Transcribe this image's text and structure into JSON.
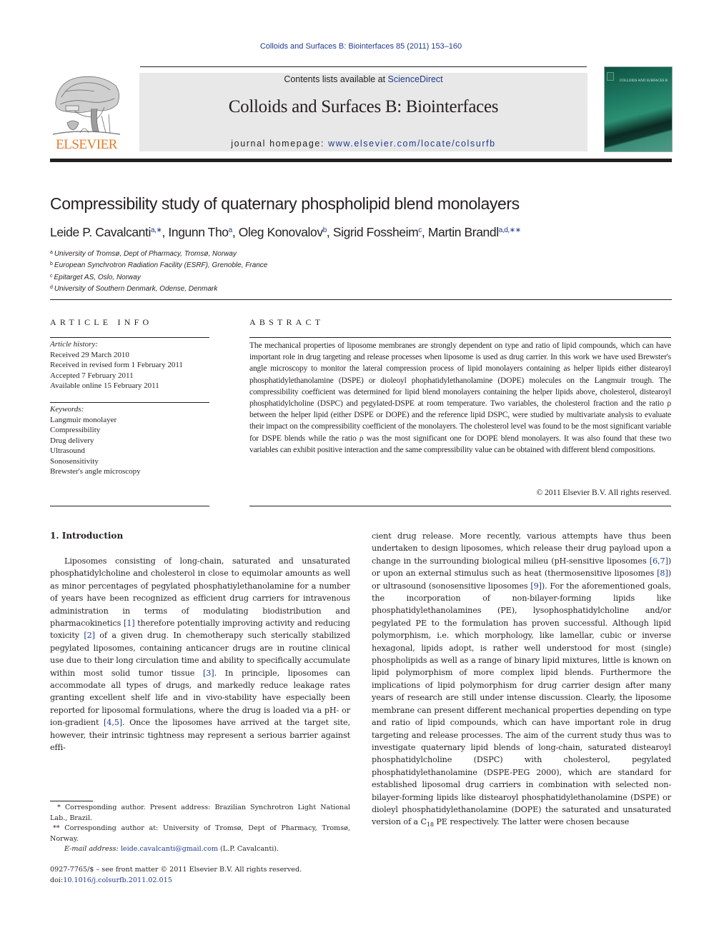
{
  "header": {
    "citation": "Colloids and Surfaces B: Biointerfaces 85 (2011) 153–160",
    "contents_prefix": "Contents lists available at ",
    "contents_link": "ScienceDirect",
    "journal_title": "Colloids and Surfaces B: Biointerfaces",
    "homepage_prefix": "journal homepage: ",
    "homepage_link": "www.elsevier.com/locate/colsurfb",
    "publisher_logo_text": "ELSEVIER",
    "cover_title": "COLLOIDS AND SURFACES B",
    "colors": {
      "link": "#1f3b8c",
      "publisher_orange": "#e8792a",
      "banner_bg": "#e8e8e8",
      "cover_green": "#1e7a62"
    }
  },
  "article": {
    "title": "Compressibility study of quaternary phospholipid blend monolayers",
    "authors": [
      {
        "name": "Leide P. Cavalcanti",
        "sup": "a,∗"
      },
      {
        "name": "Ingunn Tho",
        "sup": "a"
      },
      {
        "name": "Oleg Konovalov",
        "sup": "b"
      },
      {
        "name": "Sigrid Fossheim",
        "sup": "c"
      },
      {
        "name": "Martin Brandl",
        "sup": "a,d,∗∗"
      }
    ],
    "affiliations": [
      {
        "key": "a",
        "text": "University of Tromsø, Dept of Pharmacy, Tromsø, Norway"
      },
      {
        "key": "b",
        "text": "European Synchrotron Radiation Facility (ESRF), Grenoble, France"
      },
      {
        "key": "c",
        "text": "Epitarget AS, Oslo, Norway"
      },
      {
        "key": "d",
        "text": "University of Southern Denmark, Odense, Denmark"
      }
    ]
  },
  "article_info": {
    "heading": "ARTICLE INFO",
    "history_label": "Article history:",
    "history": [
      "Received 29 March 2010",
      "Received in revised form 1 February 2011",
      "Accepted 7 February 2011",
      "Available online 15 February 2011"
    ],
    "keywords_label": "Keywords:",
    "keywords": [
      "Langmuir monolayer",
      "Compressibility",
      "Drug delivery",
      "Ultrasound",
      "Sonosensitivity",
      "Brewster's angle microscopy"
    ]
  },
  "abstract": {
    "heading": "ABSTRACT",
    "text": "The mechanical properties of liposome membranes are strongly dependent on type and ratio of lipid compounds, which can have important role in drug targeting and release processes when liposome is used as drug carrier. In this work we have used Brewster's angle microscopy to monitor the lateral compression process of lipid monolayers containing as helper lipids either distearoyl phosphatidylethanolamine (DSPE) or dioleoyl phophatidylethanolamine (DOPE) molecules on the Langmuir trough. The compressibility coefficient was determined for lipid blend monolayers containing the helper lipids above, cholesterol, distearoyl phosphatidylcholine (DSPC) and pegylated-DSPE at room temperature. Two variables, the cholesterol fraction and the ratio ρ between the helper lipid (either DSPE or DOPE) and the reference lipid DSPC, were studied by multivariate analysis to evaluate their impact on the compressibility coefficient of the monolayers. The cholesterol level was found to be the most significant variable for DSPE blends while the ratio ρ was the most significant one for DOPE blend monolayers. It was also found that these two variables can exhibit positive interaction and the same compressibility value can be obtained with different blend compositions.",
    "copyright": "© 2011 Elsevier B.V. All rights reserved."
  },
  "introduction": {
    "heading": "1.  Introduction",
    "left_column": [
      {
        "t": "Liposomes consisting of long-chain, saturated and unsaturated phosphatidylcholine and cholesterol in close to equimolar amounts as well as minor percentages of pegylated phosphatiylethanolamine for a number of years have been recognized as efficient drug carriers for intravenous administration in terms of modulating biodistribution and pharmacokinetics "
      },
      {
        "ref": "[1]"
      },
      {
        "t": " therefore potentially improving activity and reducing toxicity "
      },
      {
        "ref": "[2]"
      },
      {
        "t": " of a given drug. In chemotherapy such sterically stabilized pegylated liposomes, containing anticancer drugs are in routine clinical use due to their long circulation time and ability to specifically accumulate within most solid tumor tissue "
      },
      {
        "ref": "[3]"
      },
      {
        "t": ". In principle, liposomes can accommodate all types of drugs, and markedly reduce leakage rates granting excellent shelf life and in vivo-stability have especially been reported for liposomal formulations, where the drug is loaded via a pH- or ion-gradient "
      },
      {
        "ref": "[4,5]"
      },
      {
        "t": ". Once the liposomes have arrived at the target site, however, their intrinsic tightness may represent a serious barrier against effi-"
      }
    ],
    "right_column": [
      {
        "t": "cient drug release. More recently, various attempts have thus been undertaken to design liposomes, which release their drug payload upon a change in the surrounding biological milieu (pH-sensitive liposomes "
      },
      {
        "ref": "[6,7]"
      },
      {
        "t": ") or upon an external stimulus such as heat (thermosensitive liposomes "
      },
      {
        "ref": "[8]"
      },
      {
        "t": ") or ultrasound (sonosensitive liposomes "
      },
      {
        "ref": "[9]"
      },
      {
        "t": "). For the aforementioned goals, the incorporation of non-bilayer-forming lipids like phosphatidylethanolamines (PE), lysophosphatidylcholine and/or pegylated PE to the formulation has proven successful. Although lipid polymorphism, i.e. which morphology, like lamellar, cubic or inverse hexagonal, lipids adopt, is rather well understood for most (single) phospholipids as well as a range of binary lipid mixtures, little is known on lipid polymorphism of more complex lipid blends. Furthermore the implications of lipid polymorphism for drug carrier design after many years of research are still under intense discussion. Clearly, the liposome membrane can present different mechanical properties depending on type and ratio of lipid compounds, which can have important role in drug targeting and release processes. The aim of the current study thus was to investigate quaternary lipid blends of long-chain, saturated distearoyl phosphatidylcholine (DSPC) with cholesterol, pegylated phosphatidylethanolamine (DSPE-PEG 2000), which are standard for established liposomal drug carriers in combination with selected non-bilayer-forming lipids like distearoyl phosphatidylethanolamine (DSPE) or dioleyl phosphatidylethanolamine (DOPE) the saturated and unsaturated version of a C"
      },
      {
        "sub": "18"
      },
      {
        "t": " PE respectively. The latter were chosen because"
      }
    ]
  },
  "footnotes": {
    "fn1": "* Corresponding author. Present address: Brazilian Synchrotron Light National Lab., Brazil.",
    "fn2": "** Corresponding author at: University of Tromsø, Dept of Pharmacy, Tromsø, Norway.",
    "email_label": "E-mail address: ",
    "email": "leide.cavalcanti@gmail.com",
    "email_suffix": " (L.P. Cavalcanti).",
    "issn": "0927-7765/$ – see front matter © 2011 Elsevier B.V. All rights reserved.",
    "doi_prefix": "doi:",
    "doi": "10.1016/j.colsurfb.2011.02.015"
  }
}
